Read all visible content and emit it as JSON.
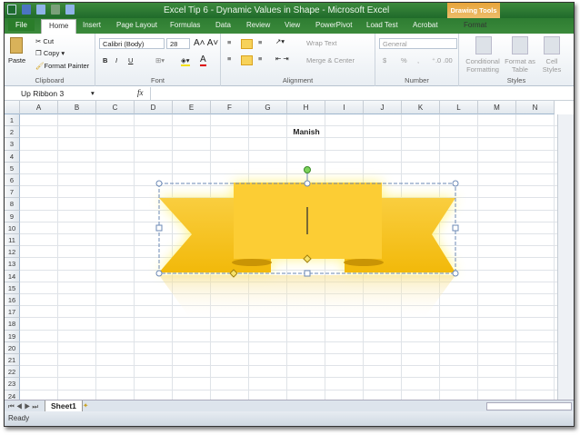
{
  "window": {
    "title": "Excel Tip 6 - Dynamic Values in Shape - Microsoft Excel",
    "contextual_tab": "Drawing Tools"
  },
  "tabs": [
    "File",
    "Home",
    "Insert",
    "Page Layout",
    "Formulas",
    "Data",
    "Review",
    "View",
    "PowerPivot",
    "Load Test",
    "Acrobat",
    "Format"
  ],
  "ribbon": {
    "clipboard": {
      "paste": "Paste",
      "cut": "Cut",
      "copy": "Copy",
      "format_painter": "Format Painter",
      "label": "Clipboard"
    },
    "font": {
      "name": "Calibri (Body)",
      "size": "28",
      "label": "Font",
      "bold": "B",
      "italic": "I",
      "underline": "U"
    },
    "alignment": {
      "wrap": "Wrap Text",
      "merge": "Merge & Center",
      "label": "Alignment"
    },
    "number": {
      "format": "General",
      "currency": "$",
      "percent": "%",
      "comma": ",",
      "label": "Number"
    },
    "styles": {
      "conditional": "Conditional Formatting",
      "table": "Format as Table",
      "cell": "Cell Styles",
      "label": "Styles"
    }
  },
  "formula_bar": {
    "name_box": "Up Ribbon 3",
    "fx": "fx",
    "value": ""
  },
  "columns": [
    "A",
    "B",
    "C",
    "D",
    "E",
    "F",
    "G",
    "H",
    "I",
    "J",
    "K",
    "L",
    "M",
    "N"
  ],
  "rows": [
    "1",
    "2",
    "3",
    "4",
    "5",
    "6",
    "7",
    "8",
    "9",
    "10",
    "11",
    "12",
    "13",
    "14",
    "15",
    "16",
    "17",
    "18",
    "19",
    "20",
    "21",
    "22",
    "23",
    "24"
  ],
  "cells": {
    "H2": "Manish"
  },
  "sheets": [
    "Sheet1"
  ],
  "status": "Ready",
  "colors": {
    "ribbon_fill": "#f7c21a",
    "title_green": "#2e7d32",
    "drawing_tools": "#e7a43a"
  }
}
